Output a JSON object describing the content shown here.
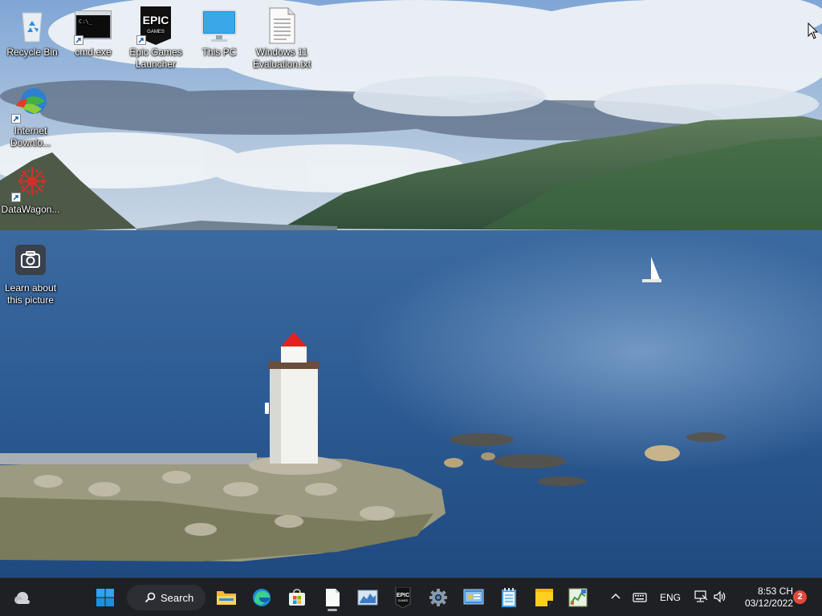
{
  "desktop": {
    "icons": [
      {
        "label": "Recycle Bin",
        "icon": "recycle-bin-icon"
      },
      {
        "label": "cmd.exe",
        "icon": "terminal-icon"
      },
      {
        "label": "Epic Games Launcher",
        "icon": "epic-games-icon"
      },
      {
        "label": "This PC",
        "icon": "monitor-icon"
      },
      {
        "label": "Windows 11 Evaluation.txt",
        "icon": "text-file-icon"
      },
      {
        "label": "Internet Downlo...",
        "icon": "internet-download-manager-icon"
      },
      {
        "label": "DataWagon...",
        "icon": "datawagon-icon"
      },
      {
        "label": "Learn about this picture",
        "icon": "camera-icon"
      }
    ]
  },
  "taskbar": {
    "search_label": "Search",
    "apps": [
      {
        "name": "widgets",
        "icon": "weather-cloud-icon"
      },
      {
        "name": "start",
        "icon": "windows-start-icon"
      },
      {
        "name": "search",
        "icon": "search-icon"
      },
      {
        "name": "file-explorer",
        "icon": "folder-icon"
      },
      {
        "name": "edge",
        "icon": "edge-browser-icon"
      },
      {
        "name": "microsoft-store",
        "icon": "store-bag-icon"
      },
      {
        "name": "notepad-file",
        "icon": "text-file-icon"
      },
      {
        "name": "chart-app",
        "icon": "chart-app-icon"
      },
      {
        "name": "epic-games",
        "icon": "epic-games-icon"
      },
      {
        "name": "settings",
        "icon": "gear-icon"
      },
      {
        "name": "control-panel",
        "icon": "control-panel-icon"
      },
      {
        "name": "notepad",
        "icon": "notepad-icon"
      },
      {
        "name": "sticky-notes",
        "icon": "sticky-note-icon"
      },
      {
        "name": "task-manager",
        "icon": "task-manager-icon"
      }
    ],
    "tray": {
      "overflow_icon": "chevron-up-icon",
      "keyboard_icon": "keyboard-icon",
      "language": "ENG",
      "network_icon": "network-icon",
      "volume_icon": "speaker-icon",
      "time": "8:53 CH",
      "date": "03/12/2022",
      "notification_count": "2"
    }
  },
  "colors": {
    "taskbar_bg": "#1f2024",
    "sky": "#6f98c9",
    "sea": "#2d5b94",
    "badge": "#e04a3a"
  }
}
